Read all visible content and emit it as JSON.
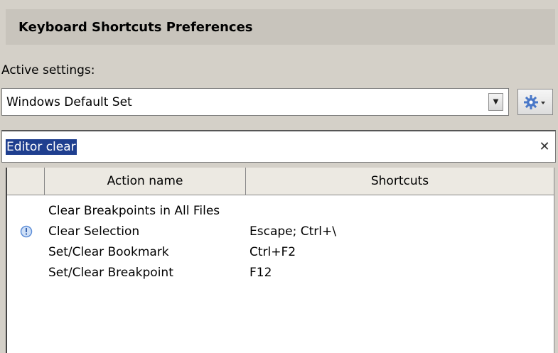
{
  "header": {
    "title": "Keyboard Shortcuts Preferences"
  },
  "active_settings": {
    "label": "Active settings:",
    "selected": "Windows Default Set"
  },
  "search": {
    "value": "Editor clear"
  },
  "table": {
    "columns": [
      "",
      "Action name",
      "Shortcuts"
    ],
    "rows": [
      {
        "action": "Clear Breakpoints in All Files",
        "shortcut": "",
        "icon": ""
      },
      {
        "action": "Clear Selection",
        "shortcut": "Escape; Ctrl+\\",
        "icon": "conflict-info-icon"
      },
      {
        "action": "Set/Clear Bookmark",
        "shortcut": "Ctrl+F2",
        "icon": ""
      },
      {
        "action": "Set/Clear Breakpoint",
        "shortcut": "F12",
        "icon": ""
      }
    ]
  },
  "colors": {
    "selection": "#1f3f8f",
    "panel": "#d4d0c8",
    "icon_blue": "#5f8fd8"
  },
  "icons": {
    "gear": "gear-icon",
    "dropdown": "chevron-down-icon",
    "clear": "close-icon"
  }
}
